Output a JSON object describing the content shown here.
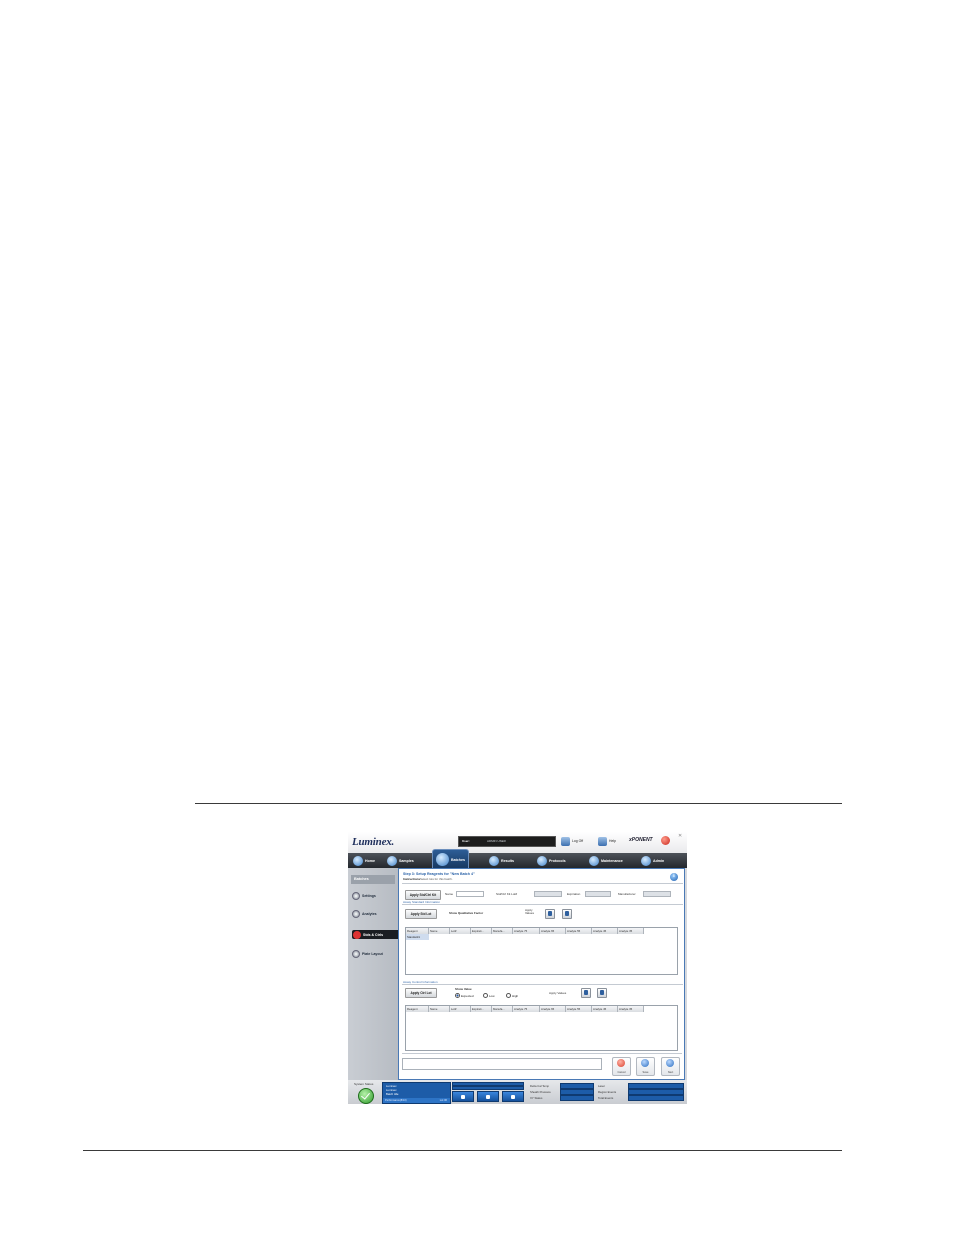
{
  "header": {
    "logo": "Luminex.",
    "user_label": "User:",
    "user_value": "ADMIN USER",
    "logoff_label": "Log Off",
    "help_label": "Help",
    "xponent_label": "xPONENT",
    "close_glyph": "✕"
  },
  "nav": {
    "tabs": [
      "Home",
      "Samples",
      "Batches",
      "Results",
      "Protocols",
      "Maintenance",
      "Admin"
    ],
    "active": "Batches"
  },
  "sidebar": {
    "title": "Batches",
    "items": [
      "Settings",
      "Analytes",
      "Stds & Ctrls",
      "Plate Layout"
    ]
  },
  "main": {
    "step_title": "Step 3: Setup Reagents for \"New Batch 4\"",
    "instructions_label": "Instructions",
    "instructions_text": "Select lots for this batch.",
    "apply_std_ctrl_kit": "Apply Std/Ctrl Kit",
    "name_label": "Name",
    "std_ctrl_lot_label": "Std/Ctrl Kit Lot#",
    "expiration_label": "Expiration",
    "manufacturer_label": "Manufacturer",
    "std_section_label": "Assay Standard Information",
    "apply_std_lot": "Apply Std Lot",
    "show_qual_factor": "Show Qualitative Factor",
    "apply_values_label": "Apply Values",
    "std_columns": [
      "Reagent",
      "Name",
      "Lot#",
      "Expirati...",
      "Manufa...",
      "Analyte 75",
      "Analyte 65",
      "Analyte 55",
      "Analyte 45",
      "Analyte 35"
    ],
    "std_rows": [
      "Standard1"
    ],
    "ctrl_section_label": "Assay Control Information",
    "apply_ctrl_lot": "Apply Ctrl Lot",
    "show_value_label": "Show Value",
    "radio_options": [
      "Expected",
      "Low",
      "High"
    ],
    "radio_selected": "Expected",
    "apply_values_label2": "Apply Values",
    "ctrl_columns": [
      "Reagent",
      "Name",
      "Lot#",
      "Expirati...",
      "Manufa...",
      "Analyte 75",
      "Analyte 65",
      "Analyte 55",
      "Analyte 45",
      "Analyte 35"
    ],
    "buttons": {
      "cancel": "Cancel",
      "save": "Save",
      "next": "Next"
    },
    "button_colors": {
      "cancel": "#d9412f",
      "save": "#2b6dbf",
      "next": "#2b6dbf"
    }
  },
  "status_bar": {
    "system_status_label": "System Status",
    "queue_lines": [
      "Luminex",
      "Luminex",
      "Batch Idle"
    ],
    "queue_footer_left": "Performance(8/10)",
    "queue_footer_right": "Lot 06",
    "stats_left": [
      "Delta Cal Temp",
      "Sheath Pressure",
      "XY Status"
    ],
    "stats_right": [
      "Laser",
      "Region Events",
      "Total Events"
    ]
  }
}
